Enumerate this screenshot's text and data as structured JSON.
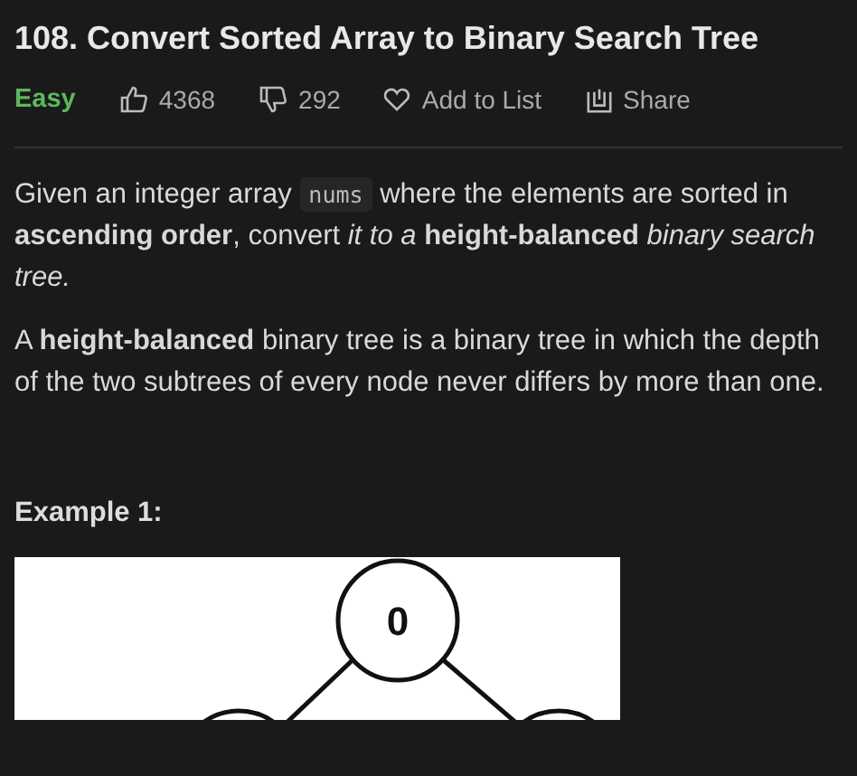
{
  "title": "108. Convert Sorted Array to Binary Search Tree",
  "difficulty": {
    "label": "Easy",
    "kind": "easy"
  },
  "actions": [
    {
      "kind": "like",
      "label": "4368"
    },
    {
      "kind": "dislike",
      "label": "292"
    },
    {
      "kind": "favorite",
      "label": "Add to List"
    },
    {
      "kind": "share",
      "label": "Share"
    }
  ],
  "description": {
    "intro": "Given an integer array",
    "code": "nums",
    "rest": "where the elements are sorted in **ascending order**, convert *it to a* **height-balanced** *binary search tree.*",
    "second": "A **height-balanced** binary tree is a binary tree in which the depth of the two subtrees of every node never differs by more than one."
  },
  "example": {
    "heading": "Example 1:",
    "tree": {
      "root": "0"
    }
  }
}
